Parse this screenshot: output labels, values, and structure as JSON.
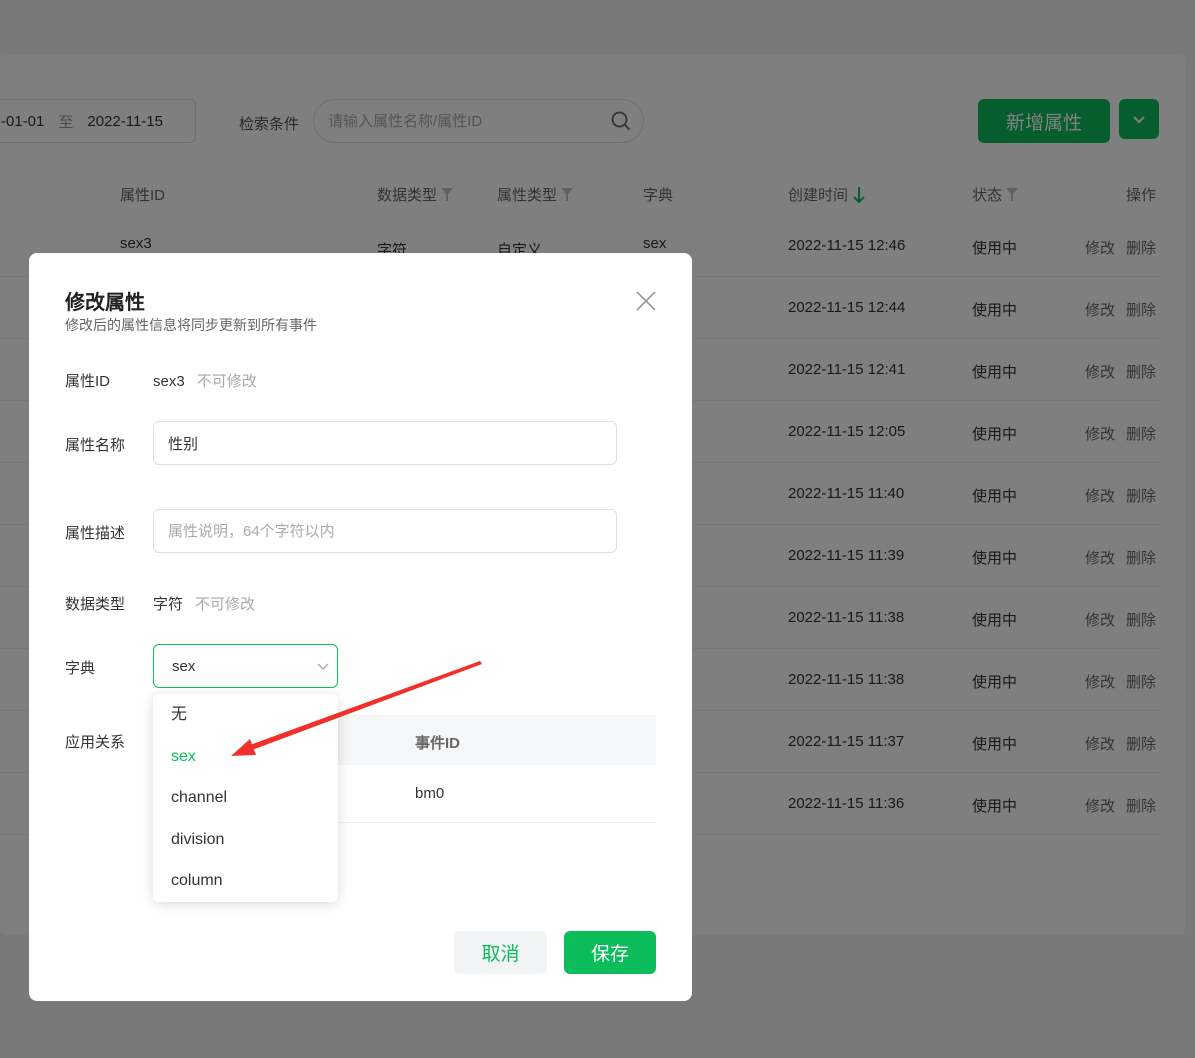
{
  "toolbar": {
    "date_start": "-01-01",
    "date_sep": "至",
    "date_end": "2022-11-15",
    "filter_label": "检索条件",
    "search_placeholder": "请输入属性名称/属性ID",
    "add_label": "新增属性"
  },
  "table": {
    "headers": {
      "attr_id": "属性ID",
      "data_type": "数据类型",
      "attr_type": "属性类型",
      "dict": "字典",
      "created": "创建时间",
      "status": "状态",
      "ops": "操作"
    },
    "first_row": {
      "attr_id": "sex3",
      "data_type": "字符",
      "attr_type": "自定义",
      "dict": "sex"
    },
    "rows": [
      {
        "created": "2022-11-15 12:46",
        "status": "使用中",
        "edit": "修改",
        "delete": "删除"
      },
      {
        "created": "2022-11-15 12:44",
        "status": "使用中",
        "edit": "修改",
        "delete": "删除"
      },
      {
        "created": "2022-11-15 12:41",
        "status": "使用中",
        "edit": "修改",
        "delete": "删除"
      },
      {
        "created": "2022-11-15 12:05",
        "status": "使用中",
        "edit": "修改",
        "delete": "删除"
      },
      {
        "created": "2022-11-15 11:40",
        "status": "使用中",
        "edit": "修改",
        "delete": "删除"
      },
      {
        "created": "2022-11-15 11:39",
        "status": "使用中",
        "edit": "修改",
        "delete": "删除"
      },
      {
        "created": "2022-11-15 11:38",
        "status": "使用中",
        "edit": "修改",
        "delete": "删除"
      },
      {
        "created": "2022-11-15 11:38",
        "status": "使用中",
        "edit": "修改",
        "delete": "删除"
      },
      {
        "created": "2022-11-15 11:37",
        "status": "使用中",
        "edit": "修改",
        "delete": "删除"
      },
      {
        "created": "2022-11-15 11:36",
        "status": "使用中",
        "edit": "修改",
        "delete": "删除"
      }
    ]
  },
  "modal": {
    "title": "修改属性",
    "subtitle": "修改后的属性信息将同步更新到所有事件",
    "attr_id_label": "属性ID",
    "attr_id_value": "sex3",
    "readonly_note": "不可修改",
    "name_label": "属性名称",
    "name_value": "性别",
    "desc_label": "属性描述",
    "desc_placeholder": "属性说明，64个字符以内",
    "type_label": "数据类型",
    "type_value": "字符",
    "type_note": "不可修改",
    "dict_label": "字典",
    "dict_value": "sex",
    "relation_label": "应用关系",
    "relation_header": "事件ID",
    "relation_value": "bm0",
    "dict_options": [
      "无",
      "sex",
      "channel",
      "division",
      "column"
    ],
    "cancel_label": "取消",
    "save_label": "保存"
  },
  "colors": {
    "accent": "#0dbd5c",
    "annotation": "#f0302a"
  },
  "icons": [
    "search-icon",
    "chevron-down-icon",
    "filter-icon",
    "sort-down-arrow-icon",
    "close-icon",
    "annotation-arrow"
  ]
}
